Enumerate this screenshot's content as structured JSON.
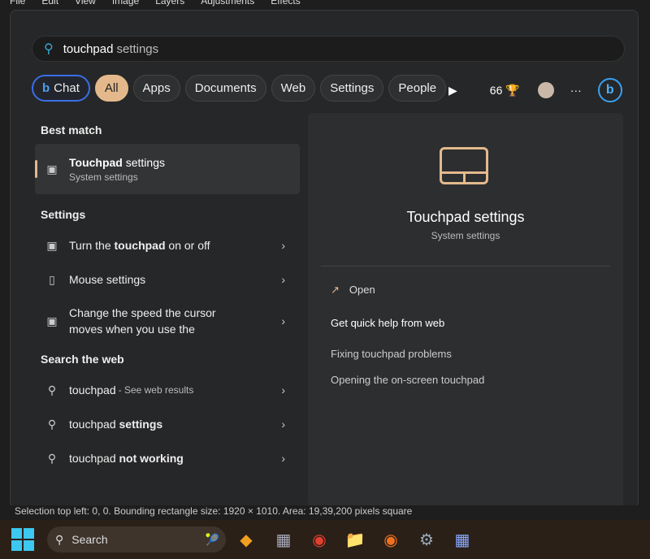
{
  "menubar": [
    "File",
    "Edit",
    "View",
    "Image",
    "Layers",
    "Adjustments",
    "Effects"
  ],
  "search": {
    "typed": "touchpad",
    "rest": "settings"
  },
  "chips": [
    "Chat",
    "All",
    "Apps",
    "Documents",
    "Web",
    "Settings",
    "People"
  ],
  "rewards_points": "66",
  "left": {
    "best_match_heading": "Best match",
    "best": {
      "title_bold": "Touchpad",
      "title_rest": " settings",
      "sub": "System settings"
    },
    "settings_heading": "Settings",
    "settings": [
      {
        "pre": "Turn the ",
        "bold": "touchpad",
        "post": " on or off",
        "icon": "touchpad-icon"
      },
      {
        "pre": "Mouse settings",
        "bold": "",
        "post": "",
        "icon": "mouse-icon"
      },
      {
        "pre": "Change the speed the cursor moves when you use the",
        "bold": "",
        "post": "",
        "icon": "touchpad-icon"
      }
    ],
    "web_heading": "Search the web",
    "web": [
      {
        "pre": "touchpad",
        "bold": "",
        "post": "",
        "hint": " - See web results"
      },
      {
        "pre": "touchpad ",
        "bold": "settings",
        "post": "",
        "hint": ""
      },
      {
        "pre": "touchpad ",
        "bold": "not working",
        "post": "",
        "hint": ""
      }
    ]
  },
  "right": {
    "title": "Touchpad settings",
    "sub": "System settings",
    "open": "Open",
    "help": "Get quick help from web",
    "links": [
      "Fixing touchpad problems",
      "Opening the on-screen touchpad"
    ]
  },
  "status": "Selection top left: 0, 0. Bounding rectangle size: 1920 × 1010. Area: 19,39,200 pixels square",
  "taskbar": {
    "search": "Search"
  },
  "colors": {
    "accent": "#e3b98c",
    "chat_border": "#3a6ee8"
  }
}
